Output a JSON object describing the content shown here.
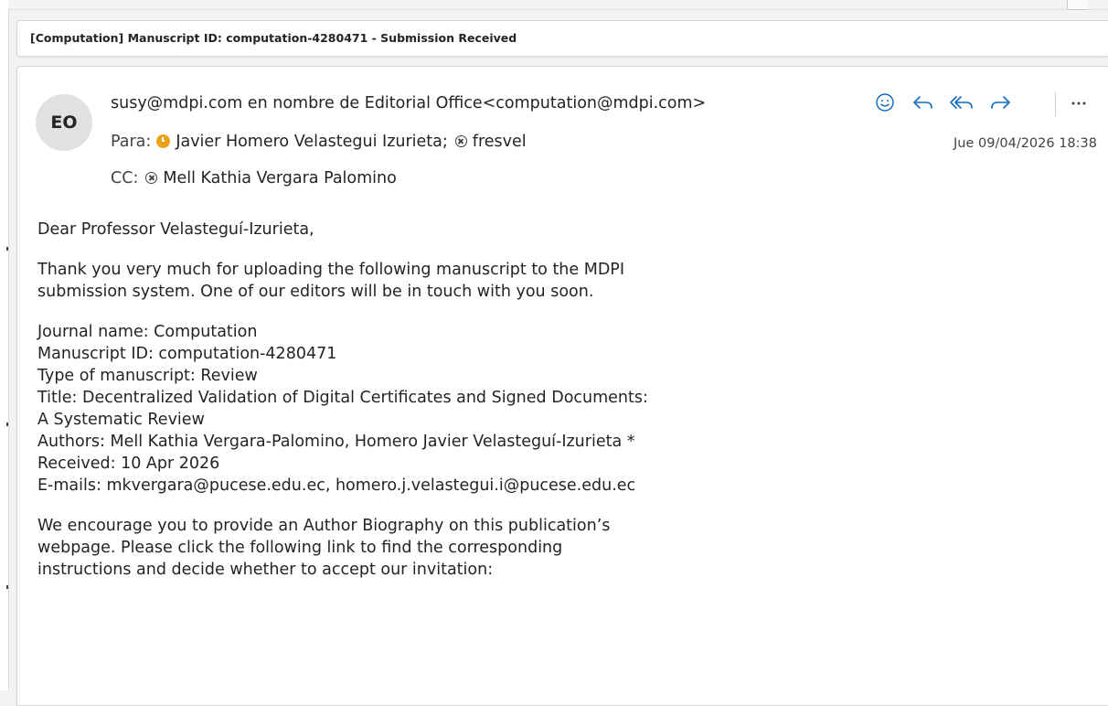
{
  "subject": "[Computation] Manuscript ID: computation-4280471 - Submission Received",
  "avatar_initials": "EO",
  "from": "susy@mdpi.com en nombre de Editorial Office<computation@mdpi.com>",
  "to": {
    "label": "Para:",
    "recipients": [
      {
        "name": "Javier Homero Velastegui Izurieta;",
        "status": "away"
      },
      {
        "name": "fresvel",
        "status": "offline"
      }
    ]
  },
  "cc": {
    "label": "CC:",
    "recipients": [
      {
        "name": "Mell Kathia Vergara Palomino",
        "status": "offline"
      }
    ]
  },
  "date": "Jue 09/04/2026 18:38",
  "actions": [
    {
      "name": "emoji-reaction",
      "icon": "smiley-icon"
    },
    {
      "name": "reply",
      "icon": "reply-icon"
    },
    {
      "name": "reply-all",
      "icon": "reply-all-icon"
    },
    {
      "name": "forward",
      "icon": "forward-icon"
    },
    {
      "name": "more-actions",
      "icon": "more-icon"
    }
  ],
  "colors": {
    "accent": "#0f6cbd",
    "away_status": "#e8a317",
    "avatar_bg": "#e1e1e1"
  },
  "body": {
    "greeting": "Dear Professor Velasteguí-Izurieta,",
    "para1": "Thank you very much for uploading the following manuscript to the MDPI\nsubmission system. One of our editors will be in touch with you soon.",
    "details": [
      "Journal name: Computation",
      "Manuscript ID: computation-4280471",
      "Type of manuscript: Review",
      "Title: Decentralized Validation of Digital Certificates and Signed Documents:",
      "A Systematic Review",
      "Authors: Mell Kathia Vergara-Palomino, Homero Javier Velasteguí-Izurieta *",
      "Received: 10 Apr 2026",
      "E-mails: mkvergara@pucese.edu.ec, homero.j.velastegui.i@pucese.edu.ec"
    ],
    "para2": "We encourage you to provide an Author Biography on this publication’s\nwebpage. Please click the following link to find the corresponding\ninstructions and decide whether to accept our invitation:"
  }
}
